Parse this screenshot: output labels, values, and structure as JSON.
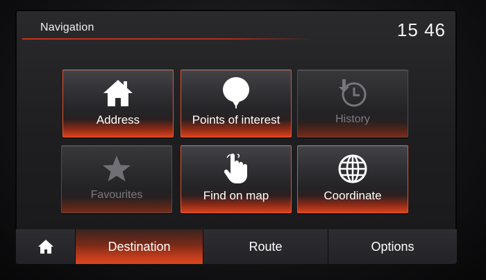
{
  "header": {
    "title": "Navigation",
    "clock": "15 46"
  },
  "tiles": [
    {
      "label": "Address",
      "icon": "house-icon",
      "enabled": true
    },
    {
      "label": "Points of interest",
      "icon": "map-pin-icon",
      "enabled": true
    },
    {
      "label": "History",
      "icon": "history-clock-icon",
      "enabled": false
    },
    {
      "label": "Favourites",
      "icon": "star-icon",
      "enabled": false
    },
    {
      "label": "Find on map",
      "icon": "hand-pointer-icon",
      "enabled": true
    },
    {
      "label": "Coordinate",
      "icon": "globe-icon",
      "enabled": true
    }
  ],
  "tabs": [
    {
      "label": "",
      "icon": "home-icon",
      "active": false
    },
    {
      "label": "Destination",
      "active": true
    },
    {
      "label": "Route",
      "active": false
    },
    {
      "label": "Options",
      "active": false
    }
  ],
  "colors": {
    "accent": "#d8431f",
    "tile_border": "#e05533",
    "disabled_text": "#7b7b80"
  }
}
